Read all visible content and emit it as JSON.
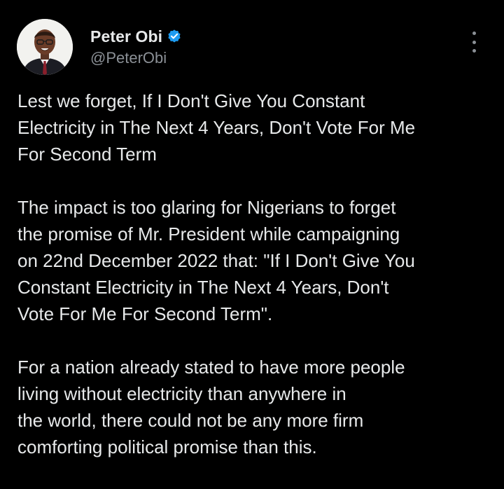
{
  "author": {
    "display_name": "Peter Obi",
    "handle": "@PeterObi",
    "verified": true
  },
  "icons": {
    "verified": "verified-badge-icon",
    "more": "more-vertical-icon"
  },
  "tweet": {
    "paragraphs": [
      "Lest we forget, If I Don't Give You Constant\nElectricity in The Next 4 Years, Don't Vote For Me\nFor Second Term",
      "The impact is too glaring for Nigerians to forget\nthe promise of Mr. President while campaigning\non 22nd December 2022 that: \"If I Don't Give You\nConstant Electricity in The Next 4 Years, Don't\nVote For Me For Second Term\".",
      "For a nation already stated to have more people\nliving without electricity than anywhere in\nthe world, there could not be any more firm\ncomforting political promise than this."
    ]
  },
  "colors": {
    "background": "#000000",
    "text": "#e7e9ea",
    "secondary_text": "#8b9096",
    "verified_blue": "#1d9bf0"
  }
}
